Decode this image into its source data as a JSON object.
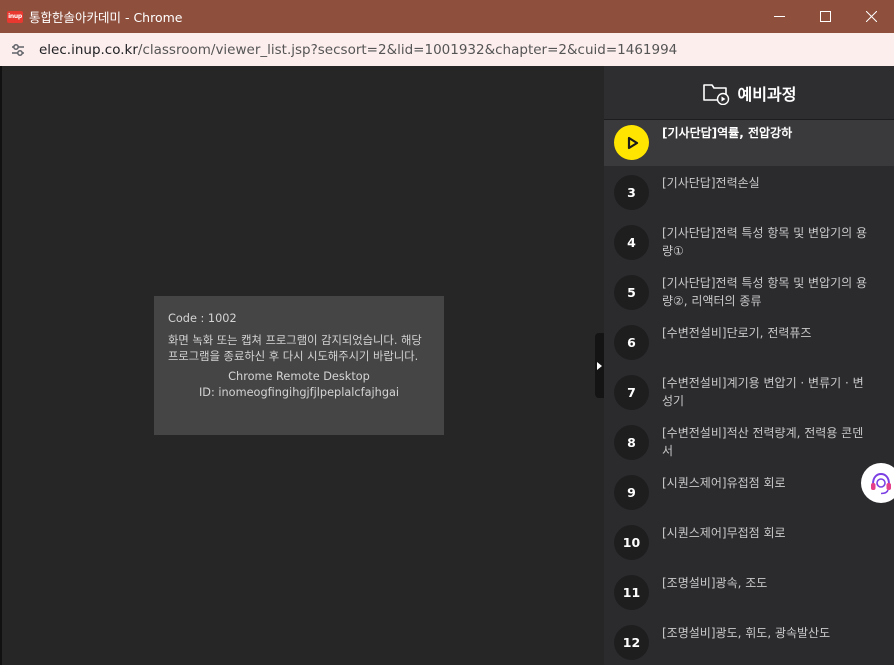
{
  "window": {
    "logo_text": "inup",
    "title": "통합한솔아카데미 - Chrome"
  },
  "addressbar": {
    "host": "elec.inup.co.kr",
    "path": "/classroom/viewer_list.jsp?secsort=2&lid=1001932&chapter=2&cuid=1461994"
  },
  "error": {
    "code": "Code : 1002",
    "message": "화면 녹화 또는 캡쳐 프로그램이 감지되었습니다. 해당 프로그램을 종료하신 후 다시 시도해주시기 바랍니다.",
    "app": "Chrome Remote Desktop",
    "id": "ID: inomeogfingihgjfjlpeplalcfajhgai"
  },
  "sidebar": {
    "title": "예비과정",
    "lessons": [
      {
        "num": "",
        "title": "[기사단답]역률, 전압강하",
        "active": true
      },
      {
        "num": "3",
        "title": "[기사단답]전력손실"
      },
      {
        "num": "4",
        "title": "[기사단답]전력 특성 항목 및 변압기의 용량①"
      },
      {
        "num": "5",
        "title": "[기사단답]전력 특성 항목 및 변압기의 용량②, 리액터의 종류"
      },
      {
        "num": "6",
        "title": "[수변전설비]단로기, 전력퓨즈"
      },
      {
        "num": "7",
        "title": "[수변전설비]계기용 변압기 · 변류기 · 변성기"
      },
      {
        "num": "8",
        "title": "[수변전설비]적산 전력량계, 전력용 콘덴서"
      },
      {
        "num": "9",
        "title": "[시퀀스제어]유접점 회로"
      },
      {
        "num": "10",
        "title": "[시퀀스제어]무접점 회로"
      },
      {
        "num": "11",
        "title": "[조명설비]광속, 조도"
      },
      {
        "num": "12",
        "title": "[조명설비]광도, 휘도, 광속발산도"
      }
    ]
  },
  "colors": {
    "titlebar": "#8e4f3d",
    "addressbar": "#fdeeee",
    "play_accent": "#ffe500",
    "support_icon": "#7b3fe4"
  }
}
